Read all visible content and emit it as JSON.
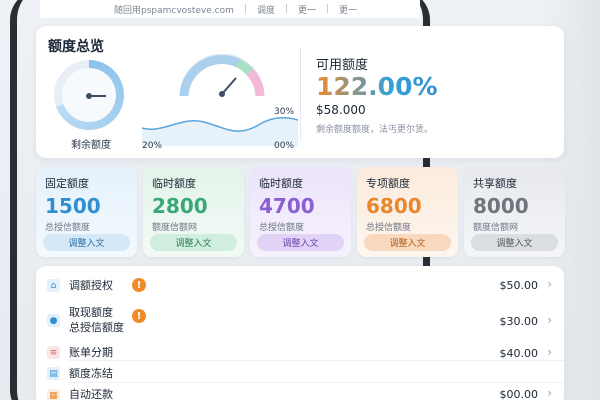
{
  "topbar": {
    "url": "随回用pspamcvosteve.com",
    "item1": "调度",
    "item2": "更一",
    "item3": "更一"
  },
  "overview": {
    "title": "额度总览",
    "ring_label": "剩余额度",
    "ring_fill_fraction": 0.7,
    "chart": {
      "label_left": "20%",
      "label_right_top": "30%",
      "label_right_bottom": "00%"
    },
    "available_title": "可用额度",
    "available_percent": "122.00%",
    "available_amount": "$58.000",
    "available_note": "剩余额度额度，法丐更尔赁。"
  },
  "quotas": [
    {
      "name": "固定额度",
      "value": "1500",
      "sub": "总授信额度",
      "button": "调整入文"
    },
    {
      "name": "临时额度",
      "value": "2800",
      "sub": "额度信额网",
      "button": "调整入文"
    },
    {
      "name": "临时额度",
      "value": "4700",
      "sub": "总授信额度",
      "button": "调整入文"
    },
    {
      "name": "专项额度",
      "value": "6800",
      "sub": "总授信额度",
      "button": "调整入文"
    },
    {
      "name": "共享额度",
      "value": "8000",
      "sub": "额度信额网",
      "button": "调整入文"
    }
  ],
  "list": [
    {
      "label": "调额授权",
      "amount": "$50.00",
      "icon": "home-icon"
    },
    {
      "label": "取现额度",
      "label2": "总授信额度",
      "amount": "$30.00",
      "icon": "user-icon"
    },
    {
      "label": "账单分期",
      "amount": "$40.00",
      "icon": "bill-icon"
    },
    {
      "label": "额度冻结",
      "amount": "",
      "icon": "freeze-icon"
    },
    {
      "label": "自动还款",
      "amount": "$00.00",
      "icon": "calendar-icon"
    }
  ],
  "colors": {
    "blue": "#2f8fd0",
    "green": "#3aa876",
    "purple": "#8a5fd3",
    "orange": "#e8872d",
    "gray": "#6f757d"
  }
}
